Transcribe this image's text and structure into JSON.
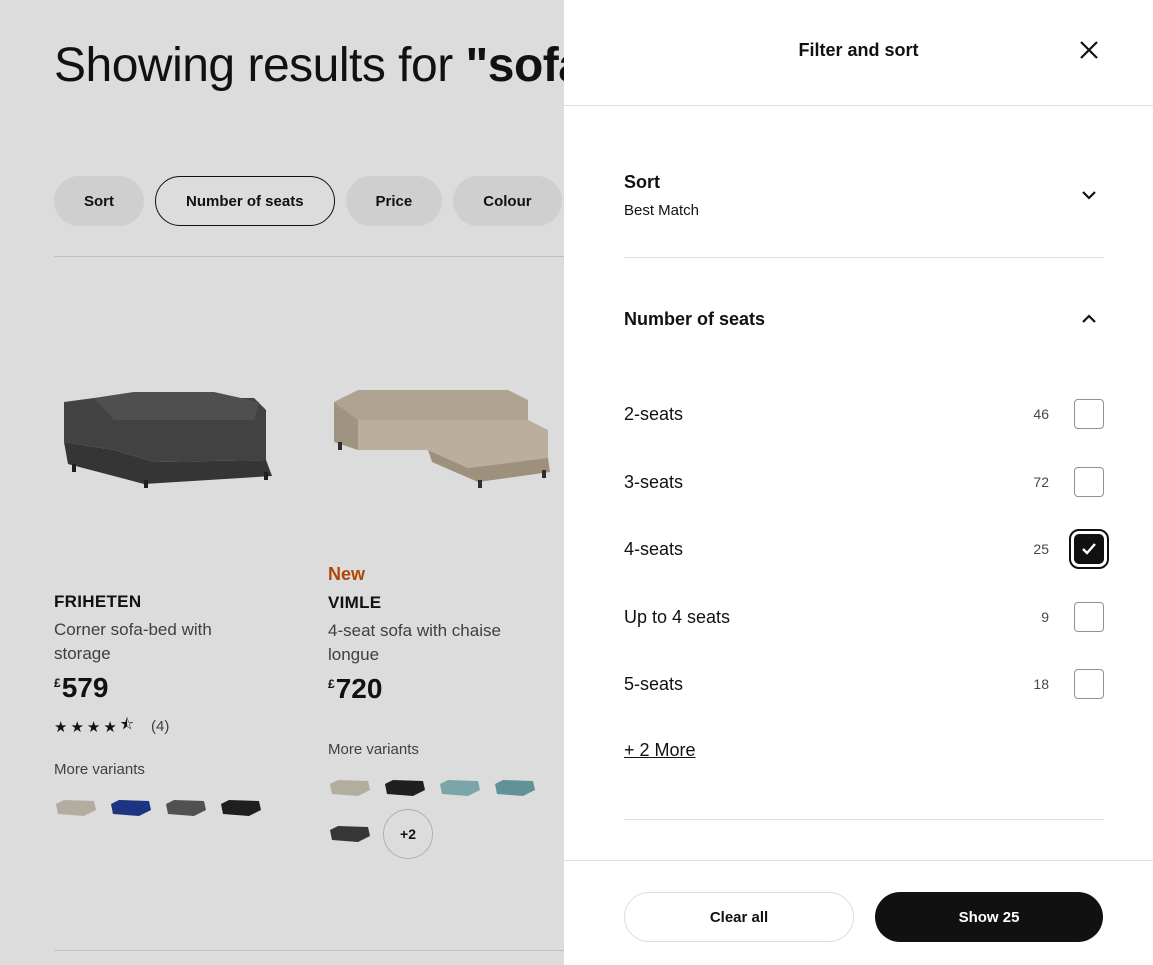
{
  "search": {
    "prefix": "Showing results for ",
    "query": "\"sofa"
  },
  "chips": [
    {
      "label": "Sort",
      "active": false
    },
    {
      "label": "Number of seats",
      "active": true
    },
    {
      "label": "Price",
      "active": false
    },
    {
      "label": "Colour",
      "active": false
    }
  ],
  "products": [
    {
      "badge": "",
      "name": "FRIHETEN",
      "description": "Corner sofa-bed with storage",
      "currency": "£",
      "price": "579",
      "rating_count": "(4)",
      "rating_value": 4.5,
      "variants_label": "More variants",
      "swatch_colors": [
        "#cfc8b8",
        "#1f3a93",
        "#5c5c5c",
        "#222222"
      ]
    },
    {
      "badge": "New",
      "name": "VIMLE",
      "description": "4-seat sofa with chaise longue",
      "currency": "£",
      "price": "720",
      "variants_label": "More variants",
      "swatch_colors": [
        "#cfc8b8",
        "#222222",
        "#8fbfc4",
        "#6fa8b0",
        "#3d3d3d"
      ],
      "more_swatches": "+2"
    }
  ],
  "drawer": {
    "title": "Filter and sort",
    "sort": {
      "title": "Sort",
      "value": "Best Match"
    },
    "seats": {
      "title": "Number of seats",
      "options": [
        {
          "label": "2-seats",
          "count": "46",
          "checked": false
        },
        {
          "label": "3-seats",
          "count": "72",
          "checked": false
        },
        {
          "label": "4-seats",
          "count": "25",
          "checked": true
        },
        {
          "label": "Up to 4 seats",
          "count": "9",
          "checked": false
        },
        {
          "label": "5-seats",
          "count": "18",
          "checked": false
        }
      ],
      "more": "+ 2 More"
    },
    "clear_label": "Clear all",
    "show_label": "Show 25"
  }
}
